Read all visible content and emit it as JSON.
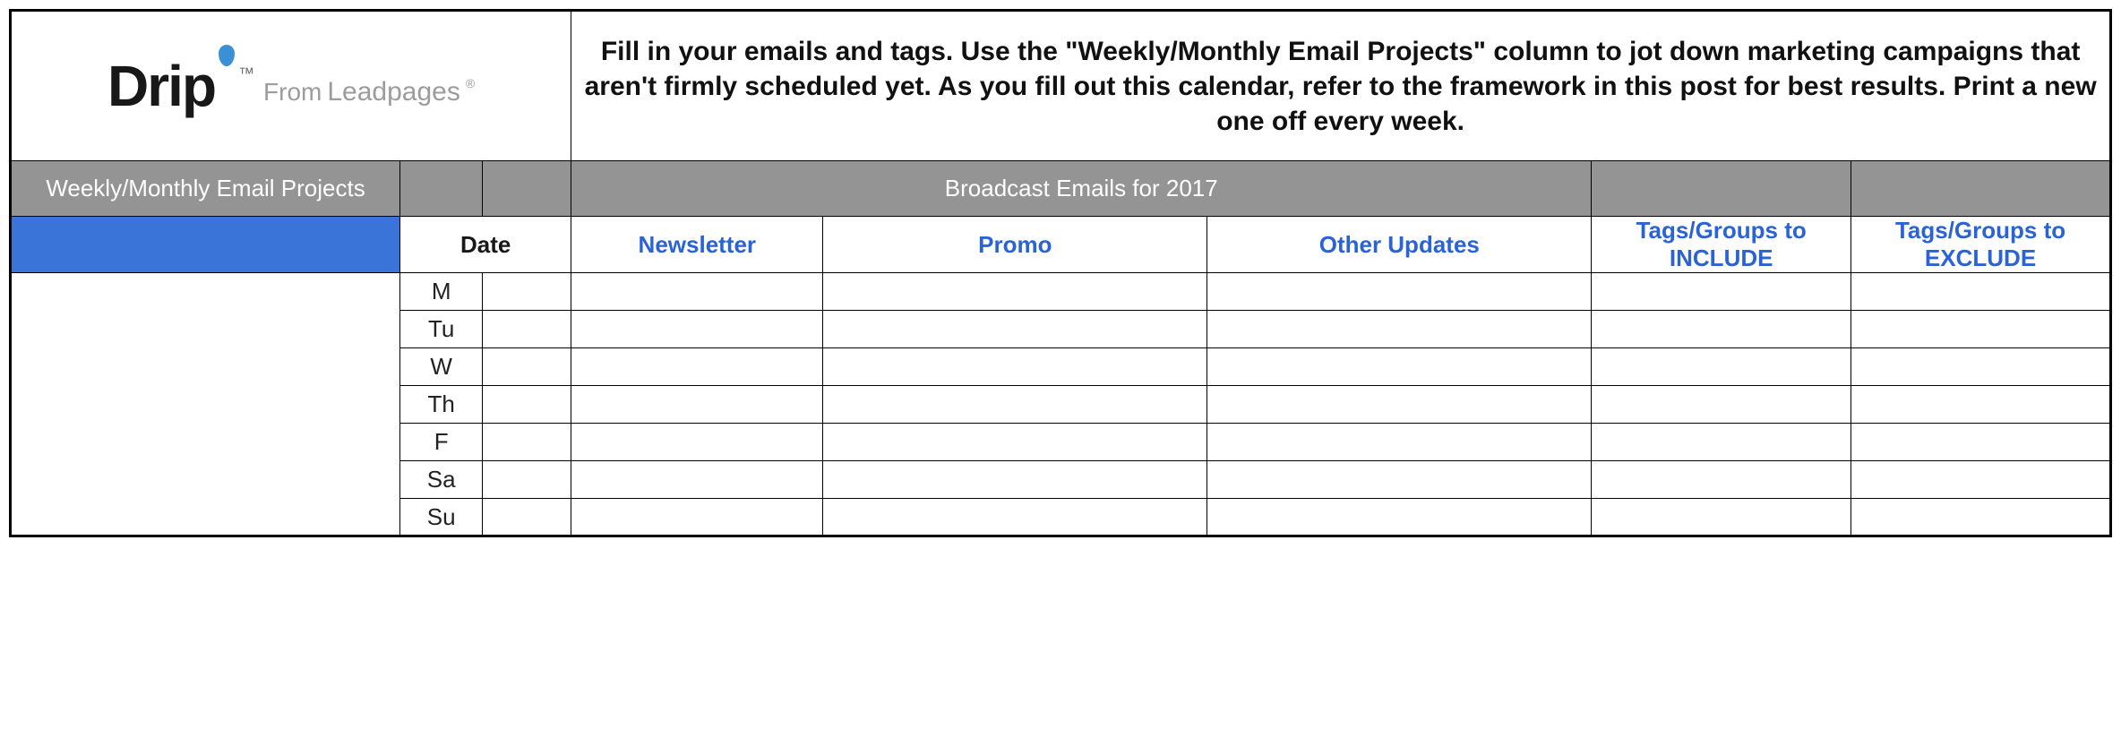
{
  "logo": {
    "main": "Drip",
    "tm": "™",
    "from": "From",
    "brand": "Leadpages",
    "reg": "®"
  },
  "instructions": "Fill in your emails and tags. Use the \"Weekly/Monthly Email Projects\" column to jot down marketing campaigns that aren't firmly scheduled yet. As you fill out this calendar, refer to the framework in this post for best results. Print a new one off every week.",
  "headers": {
    "projects": "Weekly/Monthly Email Projects",
    "broadcast": "Broadcast Emails for 2017",
    "date": "Date",
    "newsletter": "Newsletter",
    "promo": "Promo",
    "other": "Other Updates",
    "include": "Tags/Groups to INCLUDE",
    "exclude": "Tags/Groups to EXCLUDE"
  },
  "days": [
    "M",
    "Tu",
    "W",
    "Th",
    "F",
    "Sa",
    "Su"
  ]
}
